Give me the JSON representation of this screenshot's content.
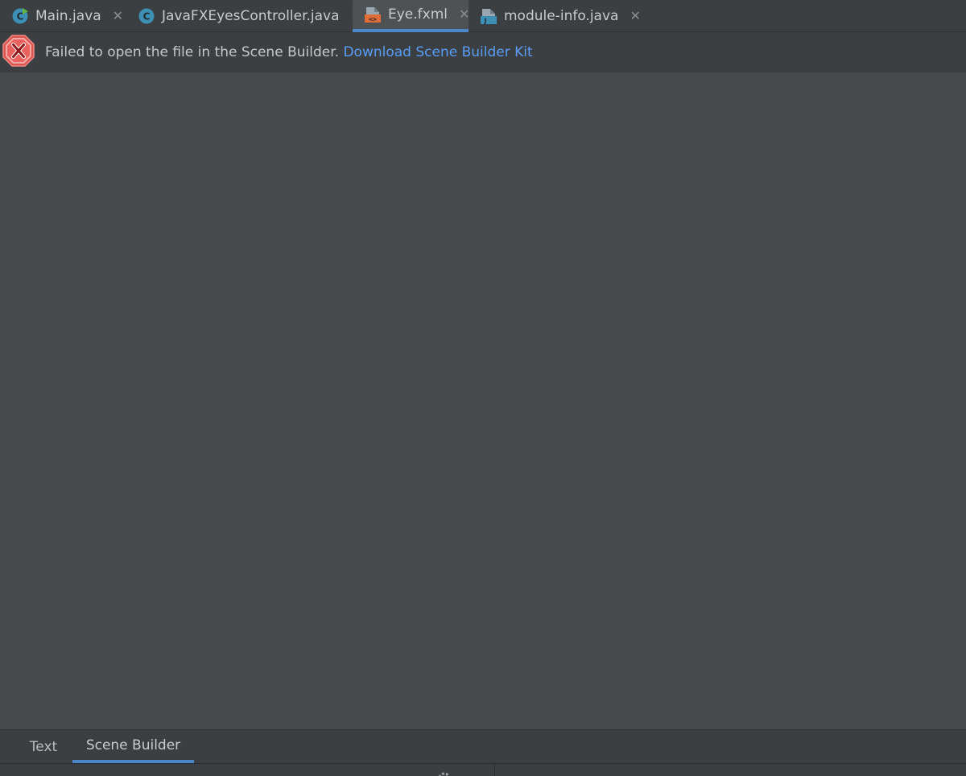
{
  "tabs": [
    {
      "label": "Main.java",
      "icon": "java-class-run-icon",
      "active": false
    },
    {
      "label": "JavaFXEyesController.java",
      "icon": "java-class-icon",
      "active": false
    },
    {
      "label": "Eye.fxml",
      "icon": "fxml-file-icon",
      "active": true
    },
    {
      "label": "module-info.java",
      "icon": "module-info-icon",
      "active": false
    }
  ],
  "tab_close_glyph": "✕",
  "notification": {
    "icon": "error-icon",
    "message": "Failed to open the file in the Scene Builder. ",
    "link": "Download Scene Builder Kit"
  },
  "bottom_tabs": [
    {
      "label": "Text",
      "active": false
    },
    {
      "label": "Scene Builder",
      "active": true
    }
  ],
  "colors": {
    "background": "#45494a",
    "tabbar": "#3c3f41",
    "accent": "#4a88c7",
    "link": "#589df6",
    "error": "#d9534f"
  }
}
